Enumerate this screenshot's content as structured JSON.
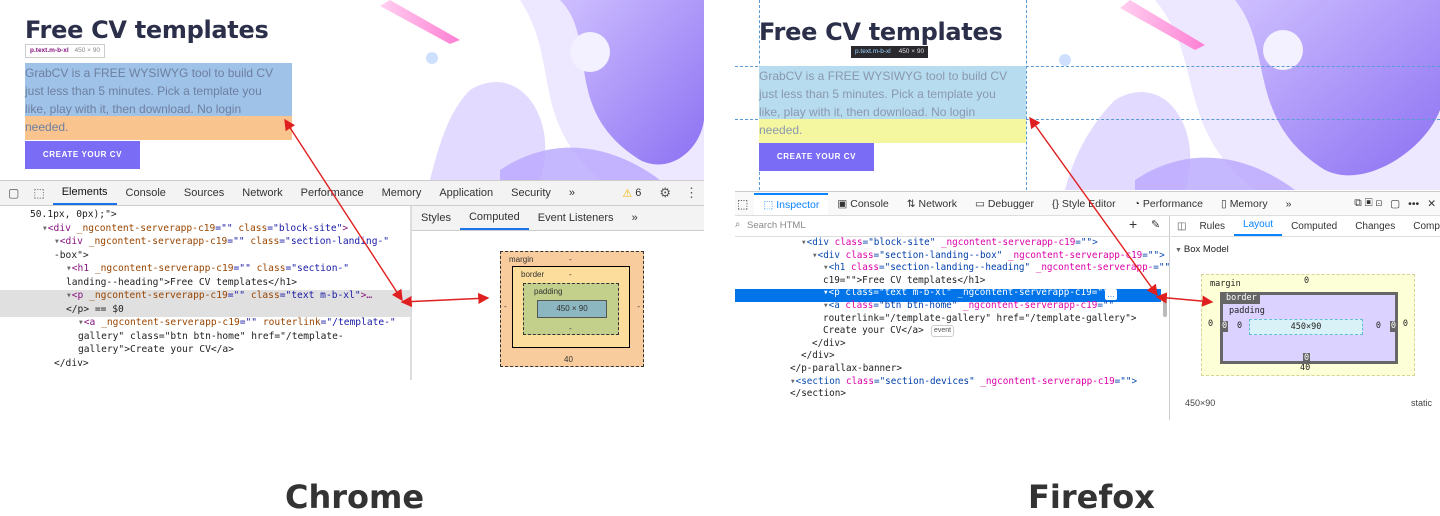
{
  "chrome": {
    "site": {
      "heading": "Free CV templates",
      "tooltip_selector": "p.text.m-b-xl",
      "tooltip_size": "450 × 90",
      "paragraph": "GrabCV is a FREE WYSIWYG tool to build CV just less than 5 minutes. Pick a template you like, play with it, then download. No login needed.",
      "cta_label": "CREATE YOUR CV"
    },
    "devtools": {
      "tabs": [
        "Elements",
        "Console",
        "Sources",
        "Network",
        "Performance",
        "Memory",
        "Application",
        "Security"
      ],
      "more": "»",
      "warning_count": "6",
      "side_tabs": [
        "Styles",
        "Computed",
        "Event Listeners"
      ],
      "side_more": "»",
      "code_lines": [
        {
          "indent": 2,
          "text": "50.1px, 0px);\">"
        },
        {
          "indent": 3,
          "tag": "div",
          "attrs": [
            [
              "_ngcontent-serverapp-c19",
              ""
            ],
            [
              "class",
              "block-site"
            ]
          ],
          "close": ">"
        },
        {
          "indent": 4,
          "tag": "div",
          "attrs": [
            [
              "_ngcontent-serverapp-c19",
              ""
            ],
            [
              "class",
              "section-landing-"
            ]
          ],
          "close": ""
        },
        {
          "indent": 4,
          "text": "-box\">"
        },
        {
          "indent": 5,
          "tag": "h1",
          "attrs": [
            [
              "_ngcontent-serverapp-c19",
              ""
            ],
            [
              "class",
              "section-"
            ]
          ],
          "close": ""
        },
        {
          "indent": 5,
          "text": "landing--heading\">Free CV templates</h1>"
        },
        {
          "indent": 5,
          "tag": "p",
          "attrs": [
            [
              "_ngcontent-serverapp-c19",
              ""
            ],
            [
              "class",
              "text m-b-xl"
            ]
          ],
          "close": ">…"
        },
        {
          "indent": 5,
          "text": "</p> == $0"
        },
        {
          "indent": 6,
          "tag": "a",
          "attrs": [
            [
              "_ngcontent-serverapp-c19",
              ""
            ],
            [
              "routerlink",
              "/template-"
            ]
          ],
          "close": ""
        },
        {
          "indent": 6,
          "text": "gallery\" class=\"btn btn-home\" href=\"/template-"
        },
        {
          "indent": 6,
          "text": "gallery\">Create your CV</a>"
        },
        {
          "indent": 4,
          "text": "</div>"
        }
      ],
      "box_model": {
        "margin_label": "margin",
        "border_label": "border",
        "padding_label": "padding",
        "content": "450 × 90",
        "dash": "-",
        "margin_bottom": "40"
      }
    },
    "caption": "Chrome"
  },
  "firefox": {
    "site": {
      "heading": "Free CV templates",
      "tooltip_selector": "p.text.m-b-xl",
      "tooltip_size": "450 × 90",
      "paragraph": "GrabCV is a FREE WYSIWYG tool to build CV just less than 5 minutes. Pick a template you like, play with it, then download. No login needed.",
      "cta_label": "CREATE YOUR CV"
    },
    "devtools": {
      "tabs": [
        "Inspector",
        "Console",
        "Network",
        "Debugger",
        "Style Editor",
        "Performance",
        "Memory"
      ],
      "more": "»",
      "search_placeholder": "Search HTML",
      "side_tabs": [
        "Rules",
        "Layout",
        "Computed",
        "Changes",
        "Comp"
      ],
      "section_title": "Box Model",
      "code_lines": [
        {
          "indent": 6,
          "tag": "div",
          "attrs": [
            [
              "class",
              "block-site"
            ],
            [
              "_ngcontent-serverapp-c19",
              ""
            ]
          ],
          "close": ">"
        },
        {
          "indent": 7,
          "tag": "div",
          "attrs": [
            [
              "class",
              "section-landing--box"
            ],
            [
              "_ngcontent-serverapp-c19",
              ""
            ]
          ],
          "close": ">"
        },
        {
          "indent": 8,
          "tag": "h1",
          "attrs": [
            [
              "class",
              "section-landing--heading"
            ],
            [
              "_ngcontent-serverapp-",
              ""
            ]
          ],
          "close": ""
        },
        {
          "indent": 8,
          "text": "c19=\"\">Free CV templates</h1>"
        },
        {
          "indent": 8,
          "tag": "p",
          "attrs": [
            [
              "class",
              "text m-b-xl"
            ],
            [
              "_ngcontent-serverapp-c19",
              ""
            ]
          ],
          "close": ">"
        },
        {
          "indent": 8,
          "tag": "a",
          "attrs": [
            [
              "class",
              "btn btn-home"
            ],
            [
              "_ngcontent-serverapp-c19",
              ""
            ]
          ],
          "close": ""
        },
        {
          "indent": 8,
          "text": "routerlink=\"/template-gallery\" href=\"/template-gallery\">"
        },
        {
          "indent": 8,
          "text": "Create your CV</a>"
        },
        {
          "indent": 7,
          "text": "</div>"
        },
        {
          "indent": 6,
          "text": "</div>"
        },
        {
          "indent": 5,
          "text": "</p-parallax-banner>"
        },
        {
          "indent": 5,
          "tag": "section",
          "attrs": [
            [
              "class",
              "section-devices"
            ],
            [
              "_ngcontent-serverapp-c19",
              ""
            ]
          ],
          "close": ">"
        },
        {
          "indent": 5,
          "text": "</section>"
        }
      ],
      "event_badge": "event",
      "more_badge": "…",
      "box_model": {
        "margin_label": "margin",
        "border_label": "border",
        "padding_label": "padding",
        "content": "450×90",
        "zero": "0",
        "margin_bottom": "40"
      },
      "footer_size": "450×90",
      "footer_position": "static"
    },
    "caption": "Firefox"
  },
  "colors": {
    "accent": "#7b6cf6",
    "chrome_highlight_content": "#9fc2e8",
    "chrome_highlight_margin": "#f9c48e",
    "firefox_highlight_content": "#b7dcf0",
    "firefox_highlight_margin": "#f5f7a0",
    "firefox_selected_row": "#0074e8",
    "arrow": "#e02020"
  }
}
